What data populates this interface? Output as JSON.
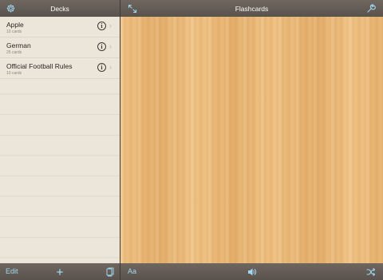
{
  "left_panel": {
    "title": "Decks",
    "decks": [
      {
        "name": "Apple",
        "count": "10 cards",
        "info": "i"
      },
      {
        "name": "German",
        "count": "25 cards",
        "info": "i"
      },
      {
        "name": "Official Football Rules",
        "count": "10 cards",
        "info": "i"
      }
    ],
    "footer": {
      "edit_label": "Edit"
    }
  },
  "right_panel": {
    "title": "Flashcards",
    "footer": {
      "font_label": "Aa"
    }
  },
  "icons": {
    "settings": "gear-icon",
    "expand": "expand-arrows-icon",
    "tools": "wrench-icon",
    "add": "plus-icon",
    "cards": "cards-icon",
    "sound": "speaker-icon",
    "shuffle": "shuffle-icon"
  },
  "colors": {
    "accent": "#9fd6f0",
    "bar": "#615a53",
    "list_bg": "#ebe5da",
    "wood": "#eab774"
  }
}
